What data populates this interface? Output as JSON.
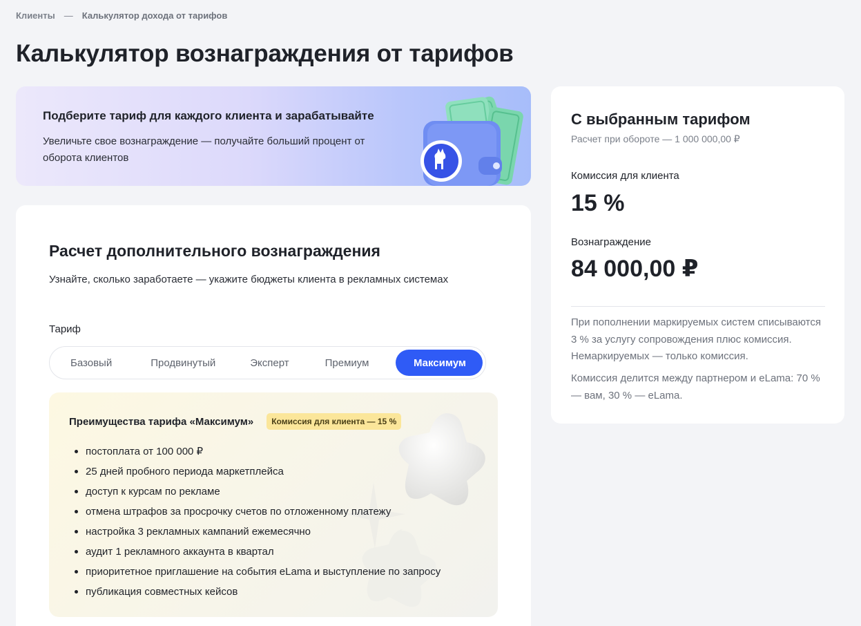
{
  "breadcrumb": {
    "root": "Клиенты",
    "separator": "—",
    "current": "Калькулятор дохода от тарифов"
  },
  "page": {
    "title": "Калькулятор вознаграждения от тарифов"
  },
  "promo": {
    "title": "Подберите тариф для каждого клиента и зарабатывайте",
    "text": "Увеличьте свое вознаграждение — получайте больший процент от оборота клиентов"
  },
  "calc": {
    "title": "Расчет дополнительного вознаграждения",
    "subtitle": "Узнайте, сколько заработаете — укажите бюджеты клиента в рекламных системах",
    "tariff_label": "Тариф",
    "tabs": [
      {
        "label": "Базовый",
        "active": false
      },
      {
        "label": "Продвинутый",
        "active": false
      },
      {
        "label": "Эксперт",
        "active": false
      },
      {
        "label": "Премиум",
        "active": false
      },
      {
        "label": "Максимум",
        "active": true
      }
    ],
    "benefits": {
      "title": "Преимущества тарифа «Максимум»",
      "badge": "Комиссия для клиента — 15 %",
      "items": [
        "постоплата от 100 000 ₽",
        "25 дней пробного периода маркетплейса",
        "доступ к курсам по рекламе",
        "отмена штрафов за просрочку счетов по отложенному платежу",
        "настройка 3 рекламных кампаний ежемесячно",
        "аудит 1 рекламного аккаунта в квартал",
        "приоритетное приглашение на события eLama и выступление по запросу",
        "публикация совместных кейсов"
      ]
    }
  },
  "summary": {
    "title": "С выбранным тарифом",
    "subtitle": "Расчет при обороте — 1 000 000,00 ₽",
    "commission_label": "Комиссия для клиента",
    "commission_value": "15 %",
    "reward_label": "Вознаграждение",
    "reward_value": "84 000,00 ₽",
    "note1": "При пополнении маркируемых систем списываются 3 % за услугу сопровождения плюс комиссия. Немаркируемых — только комиссия.",
    "note2": "Комиссия делится между партнером и eLama: 70 % — вам, 30 % — eLama."
  },
  "colors": {
    "accent": "#2f5bf6",
    "badge_bg": "#fbe69a",
    "page_bg": "#f3f4f7"
  },
  "icons": {
    "promo_art": "wallet-with-money-icon",
    "benefits_art": "star-shapes-icon"
  }
}
